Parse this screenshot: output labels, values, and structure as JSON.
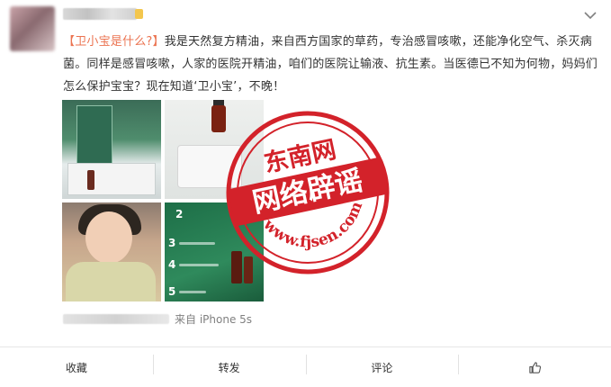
{
  "post": {
    "text_prefix": "我是天然复方精油，来自西方国家的草药，专治感冒咳嗽，还能净化空气、杀灭病菌。同样是感冒咳嗽，人家的医院开精油，咱们的医院让输液、抗生素。当医德已不知为何物，妈妈们怎么保护宝宝？现在知道‘卫小宝’，不晚！",
    "topic": "【卫小宝是什么?】",
    "source": "来自 iPhone 5s"
  },
  "stamp": {
    "top_text": "东南网",
    "center_text": "网络辟谣",
    "url_text": "www.fjsen.com"
  },
  "image_grid": {
    "image4_numbers": [
      "2",
      "3",
      "4",
      "5"
    ]
  },
  "actions": {
    "favorite_label": "收藏",
    "repost_label": "转发",
    "comment_label": "评论",
    "like_icon": "thumbs-up-icon"
  },
  "colors": {
    "topic_link": "#eb7350",
    "stamp_red": "#d3222a",
    "source_gray": "#808080"
  }
}
